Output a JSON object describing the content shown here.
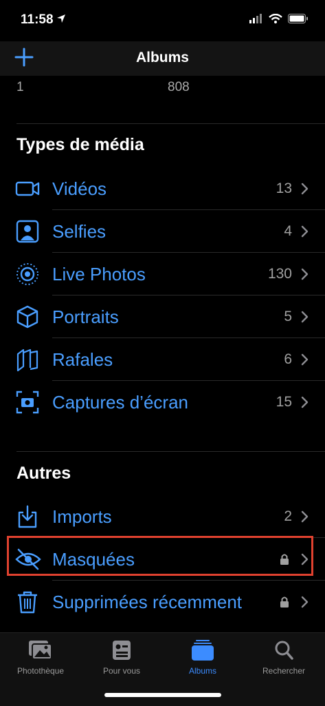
{
  "status": {
    "time": "11:58"
  },
  "nav": {
    "title": "Albums"
  },
  "cutoff": {
    "left_count": "1",
    "right_count": "808"
  },
  "media_types": {
    "title": "Types de média",
    "items": [
      {
        "label": "Vidéos",
        "count": "13",
        "icon": "video-icon"
      },
      {
        "label": "Selfies",
        "count": "4",
        "icon": "selfie-icon"
      },
      {
        "label": "Live Photos",
        "count": "130",
        "icon": "live-photos-icon"
      },
      {
        "label": "Portraits",
        "count": "5",
        "icon": "cube-icon"
      },
      {
        "label": "Rafales",
        "count": "6",
        "icon": "burst-icon"
      },
      {
        "label": "Captures d’écran",
        "count": "15",
        "icon": "screenshot-icon"
      }
    ]
  },
  "others": {
    "title": "Autres",
    "items": [
      {
        "label": "Imports",
        "count": "2",
        "icon": "import-icon"
      },
      {
        "label": "Masquées",
        "locked": true,
        "icon": "eye-slash-icon"
      },
      {
        "label": "Supprimées récemment",
        "locked": true,
        "icon": "trash-icon"
      }
    ]
  },
  "tabs": [
    {
      "label": "Photothèque",
      "icon": "photos-library-icon",
      "active": false
    },
    {
      "label": "Pour vous",
      "icon": "for-you-icon",
      "active": false
    },
    {
      "label": "Albums",
      "icon": "albums-icon",
      "active": true
    },
    {
      "label": "Rechercher",
      "icon": "search-icon",
      "active": false
    }
  ],
  "colors": {
    "accent": "#4a9eff",
    "highlight": "#e0412f",
    "background": "#000000"
  }
}
